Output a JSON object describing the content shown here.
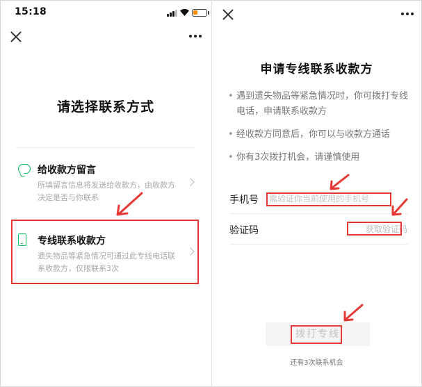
{
  "colors": {
    "accent_green": "#07c160",
    "highlight_red": "#e53935",
    "muted_text": "#a8a8a8"
  },
  "left_panel": {
    "status_bar": {
      "time": "15:18",
      "battery_level": 0.35,
      "icons": [
        "signal-icon",
        "wifi-icon",
        "battery-icon"
      ]
    },
    "title": "请选择联系方式",
    "options": [
      {
        "icon": "chat-bubble-icon",
        "title": "给收款方留言",
        "description": "所填留言信息将发送给收款方，由收款方决定是否与你联系"
      },
      {
        "icon": "phone-icon",
        "title": "专线联系收款方",
        "description": "遗失物品等紧急情况可通过此专线电话联系收款方，仅限联系3次"
      }
    ]
  },
  "right_panel": {
    "title": "申请专线联系收款方",
    "bullets": [
      "遇到遗失物品等紧急情况时，你可拨打专线电话，申请联系收款方",
      "经收款方同意后，你可以与收款方通话",
      "你有3次拨打机会，请谨慎使用"
    ],
    "phone_field": {
      "label": "手机号",
      "placeholder": "需验证你当前使用的手机号",
      "value": ""
    },
    "code_field": {
      "label": "验证码",
      "value": "",
      "get_code_label": "获取验证码"
    },
    "call_button_label": "拨打专线",
    "remaining_text": "还有3次联系机会"
  }
}
